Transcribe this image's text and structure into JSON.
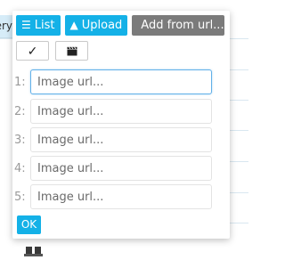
{
  "background": {
    "left_cell_text": "ery"
  },
  "popup": {
    "tabs": [
      {
        "label": "List",
        "icon": "list-icon"
      },
      {
        "label": "Upload",
        "icon": "upload-arrow-icon"
      },
      {
        "label": "Add from url...",
        "icon": "paperclip-icon"
      }
    ],
    "tool_buttons": [
      {
        "icon": "checkmark-icon",
        "glyph": "✓"
      },
      {
        "icon": "clapperboard-icon"
      }
    ],
    "url_rows": [
      {
        "number": "1:",
        "placeholder": "Image url...",
        "value": ""
      },
      {
        "number": "2:",
        "placeholder": "Image url...",
        "value": ""
      },
      {
        "number": "3:",
        "placeholder": "Image url...",
        "value": ""
      },
      {
        "number": "4:",
        "placeholder": "Image url...",
        "value": ""
      },
      {
        "number": "5:",
        "placeholder": "Image url...",
        "value": ""
      }
    ],
    "ok_label": "OK"
  },
  "colors": {
    "accent": "#14b1e7",
    "tab_gray": "#7b7b7b",
    "focus_border": "#62b0e8"
  }
}
